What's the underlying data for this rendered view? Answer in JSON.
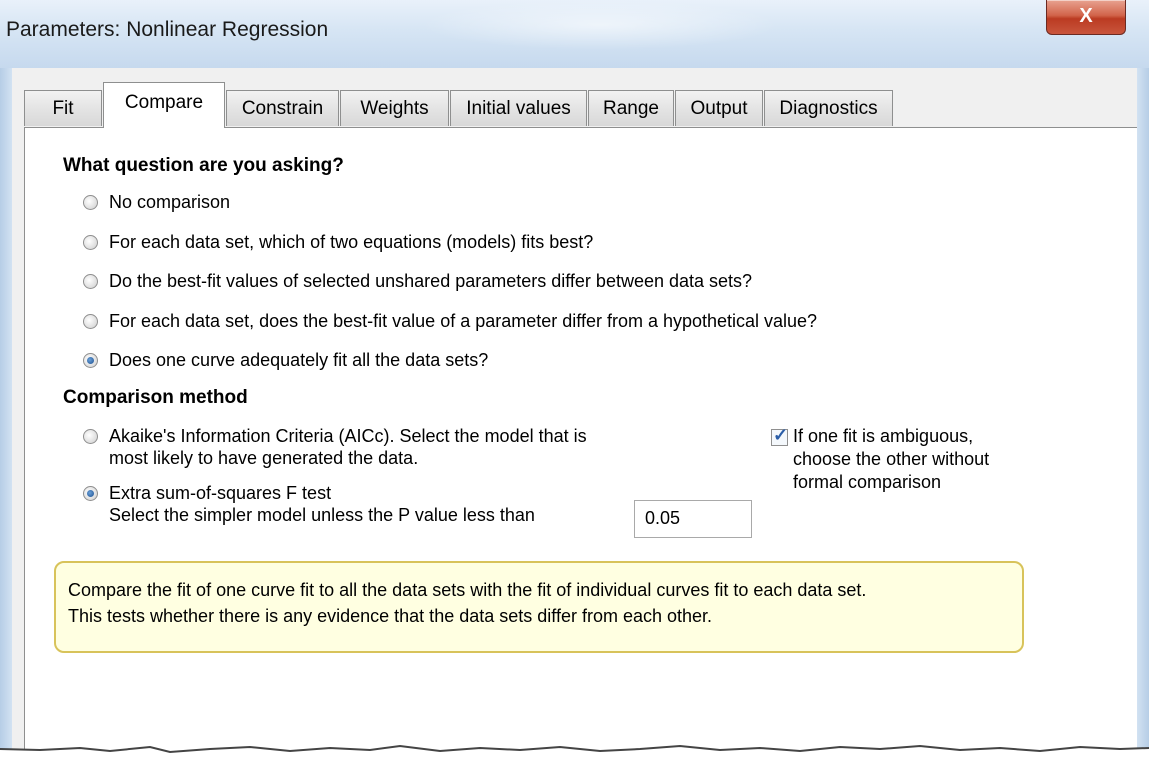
{
  "window": {
    "title": "Parameters: Nonlinear Regression",
    "close_glyph": "X"
  },
  "tabs": [
    {
      "label": "Fit",
      "active": false
    },
    {
      "label": "Compare",
      "active": true
    },
    {
      "label": "Constrain",
      "active": false
    },
    {
      "label": "Weights",
      "active": false
    },
    {
      "label": "Initial values",
      "active": false
    },
    {
      "label": "Range",
      "active": false
    },
    {
      "label": "Output",
      "active": false
    },
    {
      "label": "Diagnostics",
      "active": false
    }
  ],
  "question": {
    "heading": "What question are you asking?",
    "options": [
      {
        "label": "No comparison",
        "selected": false
      },
      {
        "label": "For each data set, which of two equations (models) fits best?",
        "selected": false
      },
      {
        "label": "Do the best-fit values of selected unshared parameters differ between data sets?",
        "selected": false
      },
      {
        "label": "For each data set, does the best-fit value of a parameter differ from a hypothetical value?",
        "selected": false
      },
      {
        "label": "Does one curve adequately fit all the data sets?",
        "selected": true
      }
    ]
  },
  "method": {
    "heading": "Comparison method",
    "aicc": {
      "line1": "Akaike's Information Criteria (AICc). Select the model that is",
      "line2": "most likely to have generated the data.",
      "selected": false
    },
    "ftest": {
      "line1": "Extra sum-of-squares F test",
      "line2": "Select the simpler model unless the P value less than",
      "selected": true,
      "p_value": "0.05"
    },
    "ambiguous": {
      "checked": true,
      "line1": "If one fit is ambiguous,",
      "line2": "choose the other without",
      "line3": "formal comparison"
    }
  },
  "note": {
    "line1": "Compare the fit of one curve fit to all the data sets with the fit of individual curves fit to each data set.",
    "line2": "This tests whether there is any evidence that the data sets differ from each other."
  },
  "colors": {
    "note_bg": "#ffffe1",
    "note_border": "#d8c35a",
    "close_red": "#c9553c"
  }
}
